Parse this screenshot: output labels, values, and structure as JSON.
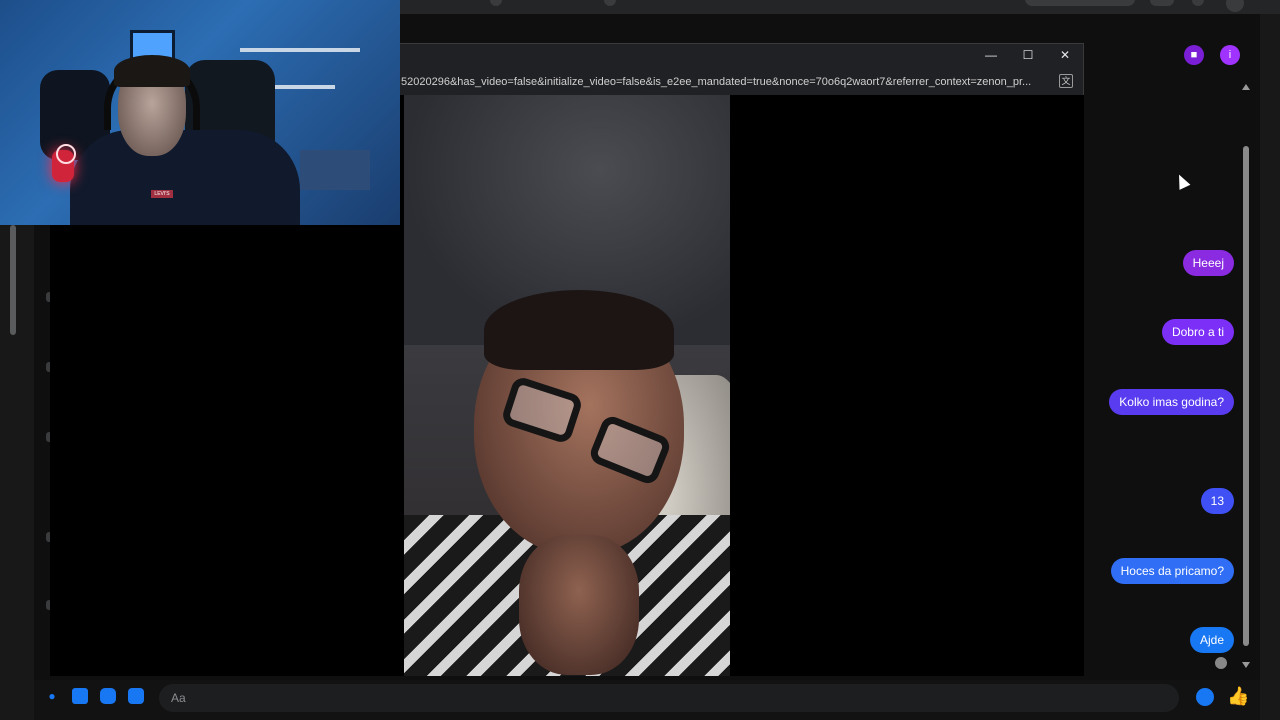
{
  "composer": {
    "placeholder": "Aa",
    "icons": [
      "microphone-icon",
      "image-icon",
      "sticker-icon",
      "gif-icon",
      "emoji-icon",
      "like-icon"
    ]
  },
  "popup": {
    "url": "52020296&has_video=false&initialize_video=false&is_e2ee_mandated=true&nonce=70o6q2waort7&referrer_context=zenon_pr...",
    "window_controls": [
      "minimize",
      "maximize",
      "close"
    ]
  },
  "messages": [
    {
      "text": "Heeej",
      "color": "#8a2be2"
    },
    {
      "text": "Dobro a ti",
      "color": "#7b2ff7"
    },
    {
      "text": "Kolko imas godina?",
      "color": "#5a3cf0"
    },
    {
      "text": "13",
      "color": "#3f51f5"
    },
    {
      "text": "Hoces da pricamo?",
      "color": "#2f6ef5"
    },
    {
      "text": "Ajde",
      "color": "#1877f2"
    }
  ],
  "header": {
    "icons": [
      "video-call-icon",
      "info-icon"
    ],
    "accent": "#a033ff"
  },
  "webcam_overlay": {
    "brand_text": "LEVI'S"
  }
}
